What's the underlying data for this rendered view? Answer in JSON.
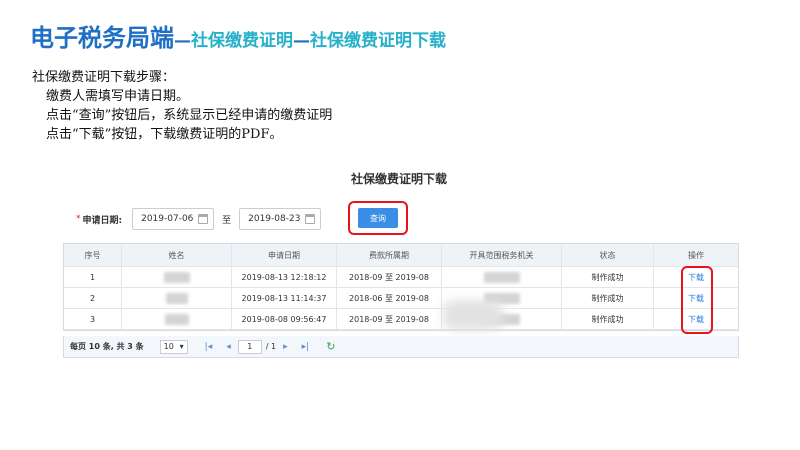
{
  "slide": {
    "title_main": "电子税务局端",
    "separator": "—",
    "title_sub1": "社保缴费证明",
    "title_sub2": "社保缴费证明下载"
  },
  "steps": {
    "heading": "社保缴费证明下载步骤：",
    "items": [
      "缴费人需填写申请日期。",
      "点击“查询”按钮后，系统显示已经申请的缴费证明",
      "点击“下载”按钮，下载缴费证明的PDF。"
    ]
  },
  "screen": {
    "page_heading": "社保缴费证明下载",
    "filter": {
      "required_mark": "*",
      "label": "申请日期:",
      "start_date": "2019-07-06",
      "to_label": "至",
      "end_date": "2019-08-23",
      "query_button": "查询"
    },
    "table": {
      "headers": [
        "序号",
        "姓名",
        "申请日期",
        "费款所属期",
        "开具范围税务机关",
        "状态",
        "操作"
      ],
      "rows": [
        {
          "no": "1",
          "date": "2019-08-13 12:18:12",
          "period": "2018-09 至 2019-08",
          "status": "制作成功",
          "action": "下载"
        },
        {
          "no": "2",
          "date": "2019-08-13 11:14:37",
          "period": "2018-06 至 2019-08",
          "status": "制作成功",
          "action": "下载"
        },
        {
          "no": "3",
          "date": "2019-08-08 09:56:47",
          "period": "2018-09 至 2019-08",
          "status": "制作成功",
          "action": "下载"
        }
      ]
    },
    "pager": {
      "summary": "每页 10 条, 共 3 条",
      "page_size": "10",
      "current_page": "1",
      "total_pages": "/ 1"
    }
  },
  "colors": {
    "title_blue": "#1f6fc4",
    "subtitle_teal": "#27b0c9",
    "highlight_red": "#e8141c",
    "button_blue": "#3a8ee6",
    "link_blue": "#2d7be0"
  }
}
